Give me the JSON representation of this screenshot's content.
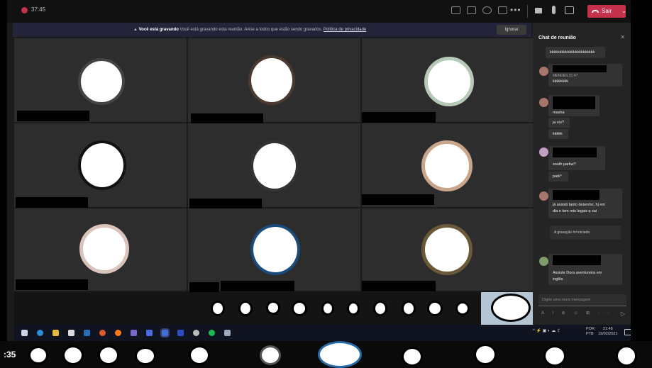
{
  "topbar": {
    "timer": "37:45",
    "leave_label": "Sair",
    "more_label": "•••"
  },
  "banner": {
    "title": "Você está gravando",
    "text": "Você está gravando esta reunião. Avise a todos que estão sendo gravados.",
    "link": "Política de privacidade",
    "ignore_label": "Ignorar"
  },
  "chat": {
    "title": "Chat de reunião",
    "close": "✕",
    "messages": [
      {
        "text": "kkkkkkkkkkkkkkkkkkkkkkk"
      },
      {
        "meta": "MENDES 21:47",
        "text": "kkkkkkkk"
      },
      {
        "lines": [
          "masha",
          "ja viu?",
          "kkkkk"
        ]
      },
      {
        "lines": [
          "south parkw?",
          "park*"
        ]
      },
      {
        "lines": [
          "já assisti tanto desenho, hj em",
          "dia n tem mts legais q sai"
        ]
      },
      {
        "text": "A gravação foi iniciada"
      },
      {
        "lines": [
          "Assiste Dora aventureira em",
          "inglês"
        ]
      }
    ],
    "compose_placeholder": "Digite uma nova mensagem",
    "compose_tools": "A ! ⊘ ☺ ⊞ ···",
    "send": "▷"
  },
  "taskbar": {
    "lang_top": "POR",
    "lang_bottom": "PTB",
    "time": "21:48",
    "date": "19/02/2021",
    "tray_icons": "^ ⚡ ▣ ◐ ☁ ⇪"
  },
  "outer": {
    "time": ":35"
  },
  "colors": {
    "leave": "#c4314b",
    "banner": "#232339",
    "chat_bg": "#242424"
  }
}
